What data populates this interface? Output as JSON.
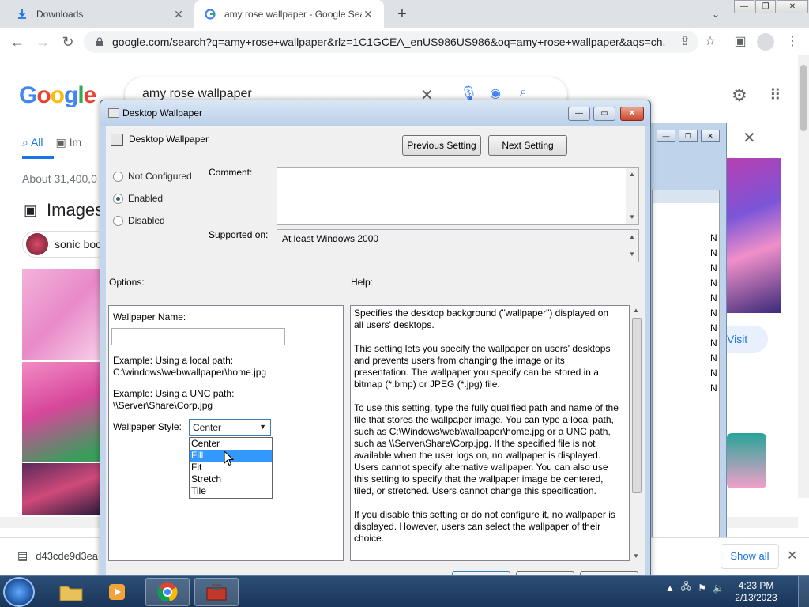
{
  "browser": {
    "tabs": [
      {
        "title": "Downloads",
        "icon": "download-icon",
        "active": false
      },
      {
        "title": "amy rose wallpaper - Google Sea",
        "icon": "google-favicon",
        "active": true
      }
    ],
    "address": "google.com/search?q=amy+rose+wallpaper&rlz=1C1GCEA_enUS986US986&oq=amy+rose+wallpaper&aqs=ch..."
  },
  "google": {
    "logo_letters": [
      "G",
      "o",
      "o",
      "g",
      "l",
      "e"
    ],
    "logo_colors": [
      "#4285f4",
      "#ea4335",
      "#fbbc05",
      "#4285f4",
      "#34a853",
      "#ea4335"
    ],
    "query": "amy rose wallpaper",
    "tabs": [
      "All",
      "Im"
    ],
    "about": "About 31,400,0",
    "images_heading": "Images",
    "chip": "sonic boo",
    "visit": "Visit"
  },
  "background_window": {
    "n_letters": [
      "N",
      "N",
      "N",
      "N",
      "N",
      "N",
      "N",
      "N",
      "N",
      "N",
      "N"
    ]
  },
  "dialog": {
    "title": "Desktop Wallpaper",
    "heading": "Desktop Wallpaper",
    "prev_button": "Previous Setting",
    "next_button": "Next Setting",
    "radios": {
      "not_configured": "Not Configured",
      "enabled": "Enabled",
      "disabled": "Disabled",
      "selected": "enabled"
    },
    "comment_label": "Comment:",
    "comment_value": "",
    "supported_label": "Supported on:",
    "supported_value": "At least Windows 2000",
    "options_label": "Options:",
    "help_label": "Help:",
    "options": {
      "wallpaper_name_label": "Wallpaper Name:",
      "wallpaper_name_value": "",
      "example_local_1": "Example: Using a local path:",
      "example_local_2": "C:\\windows\\web\\wallpaper\\home.jpg",
      "example_unc_1": "Example: Using a UNC path:",
      "example_unc_2": "\\\\Server\\Share\\Corp.jpg",
      "style_label": "Wallpaper Style:",
      "style_value": "Center",
      "style_options": [
        "Center",
        "Fill",
        "Fit",
        "Stretch",
        "Tile"
      ],
      "highlighted_option": "Fill"
    },
    "help_paragraphs": [
      "Specifies the desktop background (\"wallpaper\") displayed on all users' desktops.",
      "This setting lets you specify the wallpaper on users' desktops and prevents users from changing the image or its presentation. The wallpaper you specify can be stored in a bitmap (*.bmp) or JPEG (*.jpg) file.",
      "To use this setting, type the fully qualified path and name of the file that stores the wallpaper image. You can type a local path, such as C:\\Windows\\web\\wallpaper\\home.jpg or a UNC path, such as \\\\Server\\Share\\Corp.jpg. If the specified file is not available when the user logs on, no wallpaper is displayed. Users cannot specify alternative wallpaper. You can also use this setting to specify that the wallpaper image be centered, tiled, or stretched. Users cannot change this specification.",
      "If you disable this setting or do not configure it, no wallpaper is displayed. However, users can select the wallpaper of their choice."
    ]
  },
  "download_bar": {
    "file": "d43cde9d3ea",
    "show_all": "Show all"
  },
  "taskbar": {
    "time": "4:23 PM",
    "date": "2/13/2023"
  }
}
